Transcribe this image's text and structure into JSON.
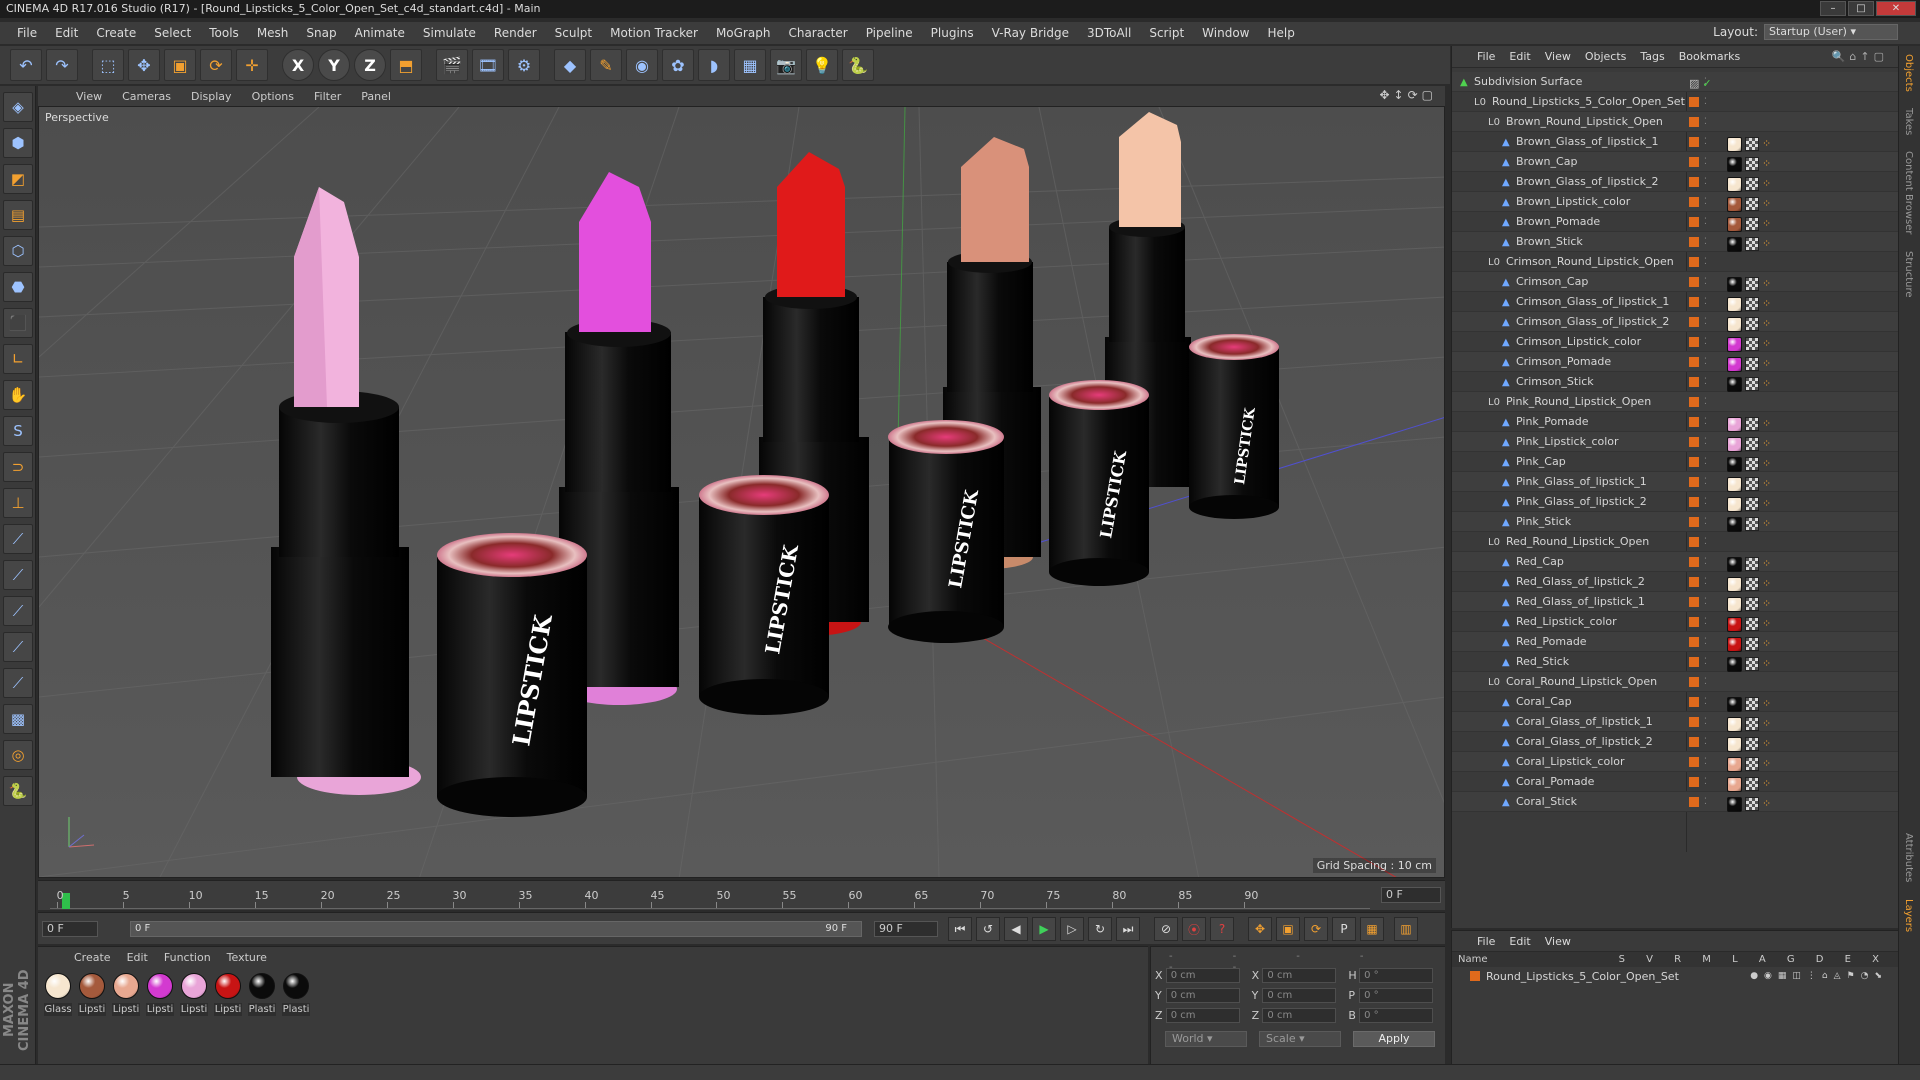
{
  "window": {
    "title": "CINEMA 4D R17.016 Studio (R17) - [Round_Lipsticks_5_Color_Open_Set_c4d_standart.c4d] - Main"
  },
  "menu": [
    "File",
    "Edit",
    "Create",
    "Select",
    "Tools",
    "Mesh",
    "Snap",
    "Animate",
    "Simulate",
    "Render",
    "Sculpt",
    "Motion Tracker",
    "MoGraph",
    "Character",
    "Pipeline",
    "Plugins",
    "V-Ray Bridge",
    "3DToAll",
    "Script",
    "Window",
    "Help"
  ],
  "layout": {
    "label": "Layout:",
    "value": "Startup (User)"
  },
  "viewport": {
    "menu": [
      "View",
      "Cameras",
      "Display",
      "Options",
      "Filter",
      "Panel"
    ],
    "label": "Perspective",
    "grid_spacing": "Grid Spacing : 10 cm",
    "label_text": "LIPSTICK"
  },
  "timeline": {
    "ticks": [
      "0",
      "5",
      "10",
      "15",
      "20",
      "25",
      "30",
      "35",
      "40",
      "45",
      "50",
      "55",
      "60",
      "65",
      "70",
      "75",
      "80",
      "85",
      "90"
    ],
    "current_field": "0 F"
  },
  "transport": {
    "start": "0 F",
    "slider_left": "0 F",
    "slider_right": "90 F",
    "end": "90 F"
  },
  "materials": {
    "menu": [
      "Create",
      "Edit",
      "Function",
      "Texture"
    ],
    "items": [
      {
        "label": "Glass",
        "color": "#f6e6cf"
      },
      {
        "label": "Lipsti",
        "color": "#a55a3c"
      },
      {
        "label": "Lipsti",
        "color": "#e8a890"
      },
      {
        "label": "Lipsti",
        "color": "#d33ad0"
      },
      {
        "label": "Lipsti",
        "color": "#e9a5d8"
      },
      {
        "label": "Lipsti",
        "color": "#c81414"
      },
      {
        "label": "Plasti",
        "color": "#0b0b0b"
      },
      {
        "label": "Plasti",
        "color": "#0b0b0b"
      }
    ]
  },
  "coordinates": {
    "header": [
      "--",
      "--",
      "--"
    ],
    "rows": [
      {
        "a1": "X",
        "v1": "0 cm",
        "a2": "X",
        "v2": "0 cm",
        "a3": "H",
        "v3": "0 °"
      },
      {
        "a1": "Y",
        "v1": "0 cm",
        "a2": "Y",
        "v2": "0 cm",
        "a3": "P",
        "v3": "0 °"
      },
      {
        "a1": "Z",
        "v1": "0 cm",
        "a2": "Z",
        "v2": "0 cm",
        "a3": "B",
        "v3": "0 °"
      }
    ],
    "world": "World",
    "scale": "Scale",
    "apply": "Apply"
  },
  "object_manager": {
    "menu": [
      "File",
      "Edit",
      "View",
      "Objects",
      "Tags",
      "Bookmarks"
    ],
    "rows": [
      {
        "name": "Subdivision Surface",
        "depth": 0,
        "type": "gen",
        "tag": null
      },
      {
        "name": "Round_Lipsticks_5_Color_Open_Set",
        "depth": 1,
        "type": "null",
        "tag": null
      },
      {
        "name": "Brown_Round_Lipstick_Open",
        "depth": 2,
        "type": "null",
        "tag": null
      },
      {
        "name": "Brown_Glass_of_lipstick_1",
        "depth": 3,
        "type": "poly",
        "tag": "#f6e6cf"
      },
      {
        "name": "Brown_Cap",
        "depth": 3,
        "type": "poly",
        "tag": "#0b0b0b"
      },
      {
        "name": "Brown_Glass_of_lipstick_2",
        "depth": 3,
        "type": "poly",
        "tag": "#f6e6cf"
      },
      {
        "name": "Brown_Lipstick_color",
        "depth": 3,
        "type": "poly",
        "tag": "#a55a3c"
      },
      {
        "name": "Brown_Pomade",
        "depth": 3,
        "type": "poly",
        "tag": "#a55a3c"
      },
      {
        "name": "Brown_Stick",
        "depth": 3,
        "type": "poly",
        "tag": "#0b0b0b"
      },
      {
        "name": "Crimson_Round_Lipstick_Open",
        "depth": 2,
        "type": "null",
        "tag": null
      },
      {
        "name": "Crimson_Cap",
        "depth": 3,
        "type": "poly",
        "tag": "#0b0b0b"
      },
      {
        "name": "Crimson_Glass_of_lipstick_1",
        "depth": 3,
        "type": "poly",
        "tag": "#f6e6cf"
      },
      {
        "name": "Crimson_Glass_of_lipstick_2",
        "depth": 3,
        "type": "poly",
        "tag": "#f6e6cf"
      },
      {
        "name": "Crimson_Lipstick_color",
        "depth": 3,
        "type": "poly",
        "tag": "#d33ad0"
      },
      {
        "name": "Crimson_Pomade",
        "depth": 3,
        "type": "poly",
        "tag": "#d33ad0"
      },
      {
        "name": "Crimson_Stick",
        "depth": 3,
        "type": "poly",
        "tag": "#0b0b0b"
      },
      {
        "name": "Pink_Round_Lipstick_Open",
        "depth": 2,
        "type": "null",
        "tag": null
      },
      {
        "name": "Pink_Pomade",
        "depth": 3,
        "type": "poly",
        "tag": "#e9a5d8"
      },
      {
        "name": "Pink_Lipstick_color",
        "depth": 3,
        "type": "poly",
        "tag": "#e9a5d8"
      },
      {
        "name": "Pink_Cap",
        "depth": 3,
        "type": "poly",
        "tag": "#0b0b0b"
      },
      {
        "name": "Pink_Glass_of_lipstick_1",
        "depth": 3,
        "type": "poly",
        "tag": "#f6e6cf"
      },
      {
        "name": "Pink_Glass_of_lipstick_2",
        "depth": 3,
        "type": "poly",
        "tag": "#f6e6cf"
      },
      {
        "name": "Pink_Stick",
        "depth": 3,
        "type": "poly",
        "tag": "#0b0b0b"
      },
      {
        "name": "Red_Round_Lipstick_Open",
        "depth": 2,
        "type": "null",
        "tag": null
      },
      {
        "name": "Red_Cap",
        "depth": 3,
        "type": "poly",
        "tag": "#0b0b0b"
      },
      {
        "name": "Red_Glass_of_lipstick_2",
        "depth": 3,
        "type": "poly",
        "tag": "#f6e6cf"
      },
      {
        "name": "Red_Glass_of_lipstick_1",
        "depth": 3,
        "type": "poly",
        "tag": "#f6e6cf"
      },
      {
        "name": "Red_Lipstick_color",
        "depth": 3,
        "type": "poly",
        "tag": "#c81414"
      },
      {
        "name": "Red_Pomade",
        "depth": 3,
        "type": "poly",
        "tag": "#c81414"
      },
      {
        "name": "Red_Stick",
        "depth": 3,
        "type": "poly",
        "tag": "#0b0b0b"
      },
      {
        "name": "Coral_Round_Lipstick_Open",
        "depth": 2,
        "type": "null",
        "tag": null
      },
      {
        "name": "Coral_Cap",
        "depth": 3,
        "type": "poly",
        "tag": "#0b0b0b"
      },
      {
        "name": "Coral_Glass_of_lipstick_1",
        "depth": 3,
        "type": "poly",
        "tag": "#f6e6cf"
      },
      {
        "name": "Coral_Glass_of_lipstick_2",
        "depth": 3,
        "type": "poly",
        "tag": "#f6e6cf"
      },
      {
        "name": "Coral_Lipstick_color",
        "depth": 3,
        "type": "poly",
        "tag": "#e8a890"
      },
      {
        "name": "Coral_Pomade",
        "depth": 3,
        "type": "poly",
        "tag": "#e8a890"
      },
      {
        "name": "Coral_Stick",
        "depth": 3,
        "type": "poly",
        "tag": "#0b0b0b"
      }
    ]
  },
  "layer_manager": {
    "menu": [
      "File",
      "Edit",
      "View"
    ],
    "header_name": "Name",
    "header_cols": "S V R M L A G D E X",
    "row": "Round_Lipsticks_5_Color_Open_Set"
  },
  "side_tabs": [
    "Objects",
    "Takes",
    "Content Browser",
    "Structure"
  ],
  "side_tabs_bottom": [
    "Attributes",
    "Layers"
  ],
  "brand": "MAXON CINEMA 4D",
  "colors": {
    "accent": "#f2a030",
    "play": "#3fd05a",
    "layer": "#e06a1c"
  }
}
